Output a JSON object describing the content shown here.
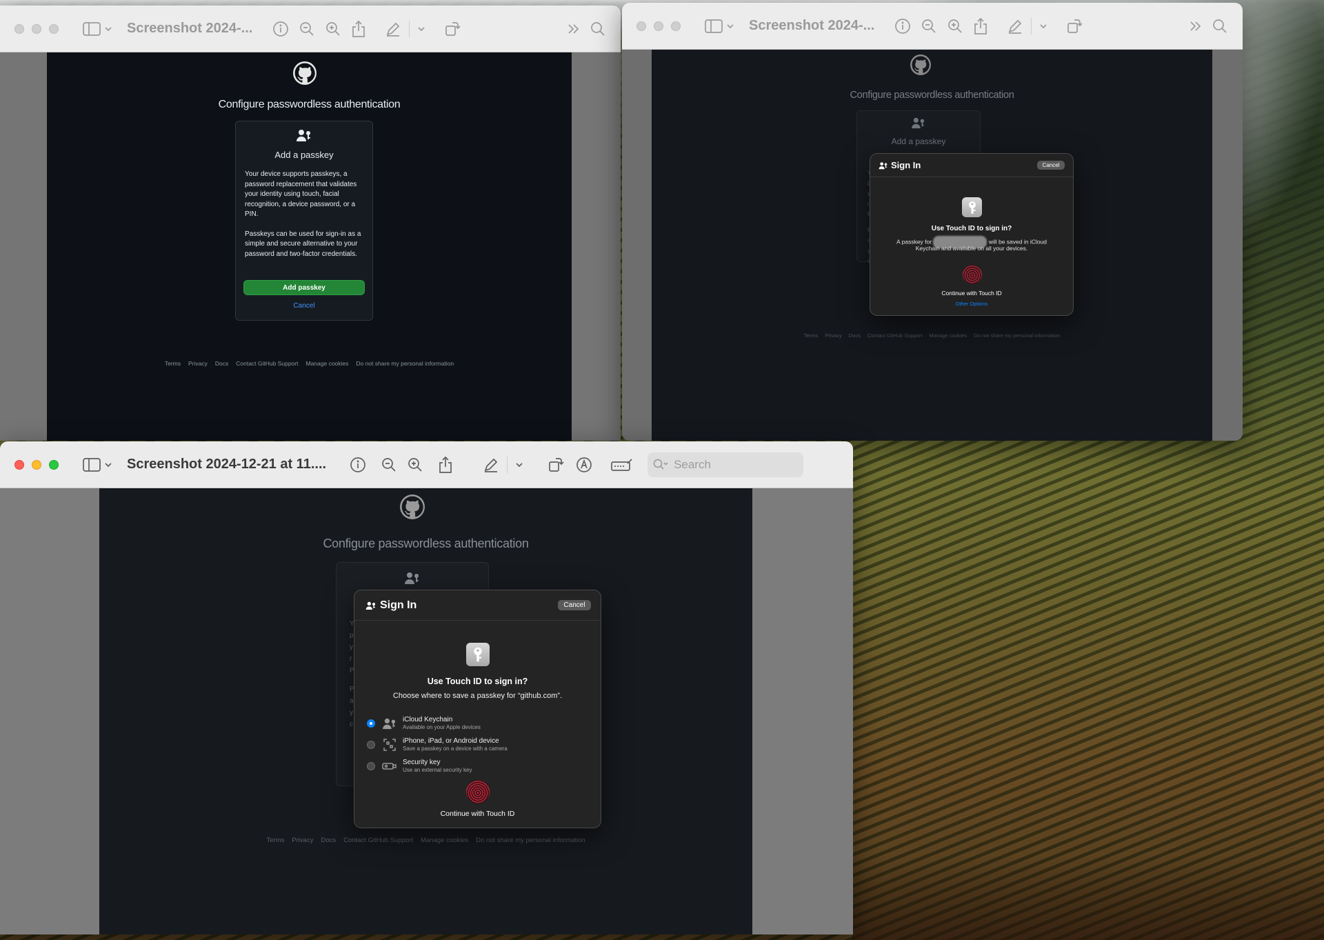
{
  "windows": [
    {
      "title": "Screenshot 2024-...",
      "page": {
        "heading": "Configure passwordless authentication",
        "card": {
          "title": "Add a passkey",
          "para1": "Your device supports passkeys, a password replacement that validates your identity using touch, facial recognition, a device password, or a PIN.",
          "para2": "Passkeys can be used for sign-in as a simple and secure alternative to your password and two-factor credentials.",
          "primary_button": "Add passkey",
          "cancel_link": "Cancel"
        },
        "footer": [
          "Terms",
          "Privacy",
          "Docs",
          "Contact GitHub Support",
          "Manage cookies",
          "Do not share my personal information"
        ]
      }
    },
    {
      "title": "Screenshot 2024-...",
      "page": {
        "heading": "Configure passwordless authentication",
        "card_title": "Add a passkey",
        "card_stub_letters": [
          "Y",
          "p",
          "y",
          "r",
          "P",
          "P",
          "a",
          "y",
          "c"
        ],
        "footer": [
          "Terms",
          "Privacy",
          "Docs",
          "Contact GitHub Support",
          "Manage cookies",
          "Do not share my personal information"
        ]
      },
      "sheet": {
        "title": "Sign In",
        "cancel": "Cancel",
        "question": "Use Touch ID to sign in?",
        "line1_prefix": "A passkey for",
        "line1_suffix": "will be saved in iCloud",
        "line2": "Keychain and available on all your devices.",
        "continue": "Continue with Touch ID",
        "other_options": "Other Options"
      }
    },
    {
      "title": "Screenshot 2024-12-21 at 11....",
      "search_placeholder": "Search",
      "page": {
        "heading": "Configure passwordless authentication",
        "card_stub_letters": [
          "Y",
          "p",
          "y",
          "r",
          "P",
          "P",
          "a",
          "y",
          "c"
        ],
        "footer": [
          "Terms",
          "Privacy",
          "Docs",
          "Contact GitHub Support",
          "Manage cookies",
          "Do not share my personal information"
        ]
      },
      "sheet": {
        "title": "Sign In",
        "cancel": "Cancel",
        "question": "Use Touch ID to sign in?",
        "subtitle": "Choose where to save a passkey for “github.com”.",
        "options": [
          {
            "title": "iCloud Keychain",
            "desc": "Available on your Apple devices",
            "selected": true,
            "icon": "person-key-icon"
          },
          {
            "title": "iPhone, iPad, or Android device",
            "desc": "Save a passkey on a device with a camera",
            "selected": false,
            "icon": "qr-code-icon"
          },
          {
            "title": "Security key",
            "desc": "Use an external security key",
            "selected": false,
            "icon": "usb-key-icon"
          }
        ],
        "continue": "Continue with Touch ID"
      }
    }
  ],
  "colors": {
    "github_bg": "#0d1117",
    "github_green": "#238636",
    "github_link": "#4493f8",
    "macos_blue": "#0a84ff",
    "touchid_red": "#b3283a",
    "traffic_red": "#fe5f57",
    "traffic_yellow": "#febc2e",
    "traffic_green": "#28c840"
  }
}
